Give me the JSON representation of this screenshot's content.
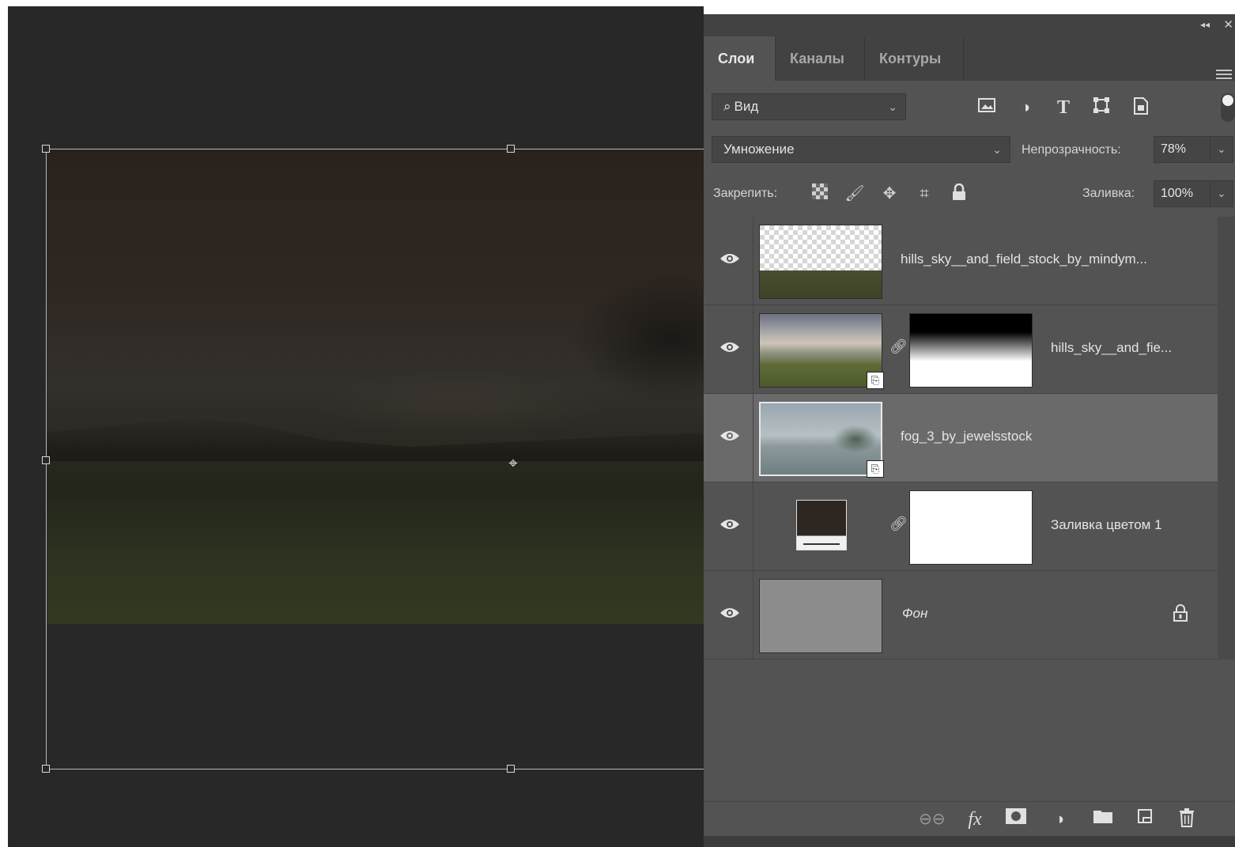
{
  "panel": {
    "tabs": [
      "Слои",
      "Каналы",
      "Контуры"
    ],
    "active_tab": "Слои"
  },
  "filter": {
    "kind_label": "Вид",
    "icons": [
      "image-filter-icon",
      "adjustment-filter-icon",
      "type-filter-icon",
      "shape-filter-icon",
      "smart-object-filter-icon"
    ]
  },
  "blend": {
    "mode": "Умножение",
    "opacity_label": "Непрозрачность:",
    "opacity_value": "78%"
  },
  "lock": {
    "label": "Закрепить:",
    "fill_label": "Заливка:",
    "fill_value": "100%"
  },
  "layers": [
    {
      "name": "hills_sky__and_field_stock_by_mindym...",
      "visible": true,
      "selected": false
    },
    {
      "name": "hills_sky__and_fie...",
      "visible": true,
      "selected": false,
      "has_mask": true
    },
    {
      "name": "fog_3_by_jewelsstock",
      "visible": true,
      "selected": true
    },
    {
      "name": "Заливка цветом 1",
      "visible": true,
      "selected": false,
      "has_mask": true,
      "fill_color": "#2e2621"
    },
    {
      "name": "Фон",
      "visible": true,
      "selected": false,
      "locked": true
    }
  ],
  "bottom_icons": [
    "link-layers-icon",
    "fx-icon",
    "add-mask-icon",
    "adjustment-layer-icon",
    "group-folder-icon",
    "new-layer-icon",
    "trash-icon"
  ],
  "colors": {
    "panel_bg": "#535353",
    "selected_layer": "#6a6a6a",
    "canvas_bg": "#282828"
  }
}
